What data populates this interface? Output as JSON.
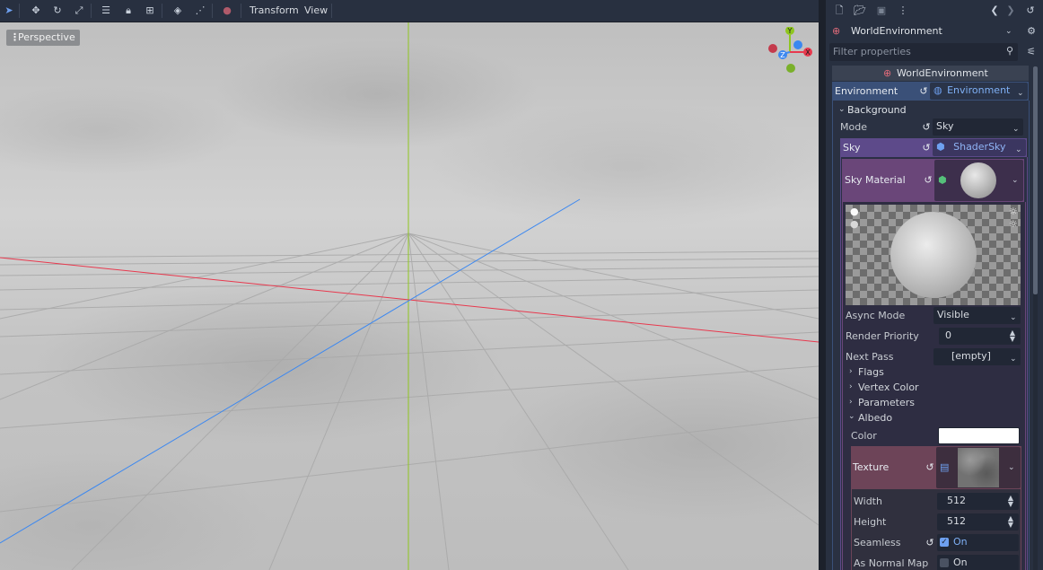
{
  "toolbar": {
    "icons": [
      "select-icon",
      "move-icon",
      "rotate-icon",
      "scale-icon",
      "list-icon",
      "lock-icon",
      "group-icon",
      "local-space-icon",
      "snap-icon",
      "camera-icon"
    ],
    "menus": {
      "transform": "Transform",
      "view": "View"
    }
  },
  "viewport": {
    "perspective_label": "Perspective",
    "gizmo": {
      "y": "Y",
      "x": "X",
      "z": "Z"
    },
    "colors": {
      "x_axis": "#e8394e",
      "y_axis": "#8fc61f",
      "z_axis": "#3c88f0"
    }
  },
  "inspector": {
    "object_name": "WorldEnvironment",
    "filter_placeholder": "Filter properties",
    "header": "WorldEnvironment",
    "environment": {
      "label": "Environment",
      "value": "Environment"
    },
    "background_section": "Background",
    "mode": {
      "label": "Mode",
      "value": "Sky"
    },
    "sky": {
      "label": "Sky",
      "value": "ShaderSky"
    },
    "sky_material": {
      "label": "Sky Material"
    },
    "async_mode": {
      "label": "Async Mode",
      "value": "Visible"
    },
    "render_priority": {
      "label": "Render Priority",
      "value": "0"
    },
    "next_pass": {
      "label": "Next Pass",
      "value": "[empty]"
    },
    "groups": {
      "flags": "Flags",
      "vertex_color": "Vertex Color",
      "parameters": "Parameters",
      "albedo": "Albedo"
    },
    "color": {
      "label": "Color",
      "value_color": "#ffffff"
    },
    "texture": {
      "label": "Texture"
    },
    "width": {
      "label": "Width",
      "value": "512"
    },
    "height": {
      "label": "Height",
      "value": "512"
    },
    "seamless": {
      "label": "Seamless",
      "value": "On",
      "checked": true
    },
    "as_normal_map": {
      "label": "As Normal Map",
      "value": "On",
      "checked": false
    },
    "colors": {
      "environment_row": "#3a5078",
      "sky_row": "#5d4a8a",
      "material_row": "#6a4679",
      "texture_row": "#6d4458",
      "accent": "#6ea0f0"
    }
  }
}
